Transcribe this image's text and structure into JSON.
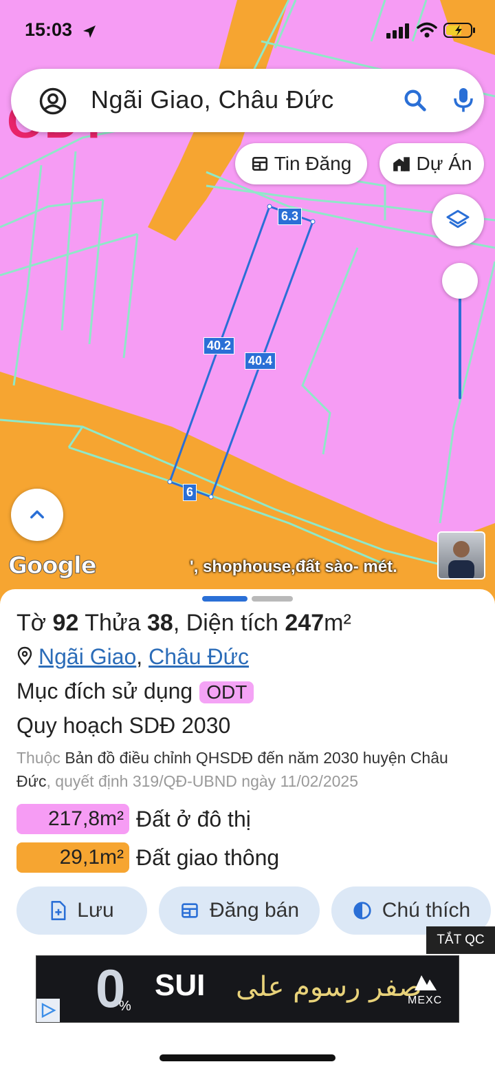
{
  "status_bar": {
    "time": "15:03"
  },
  "search": {
    "query": "Ngãi Giao, Châu Đức"
  },
  "chips": {
    "tin_dang": "Tin Đăng",
    "du_an": "Dự Án"
  },
  "map": {
    "edge_labels": [
      "6.3",
      "40.2",
      "40.4",
      "6"
    ],
    "odt_watermark": "ODT",
    "google_logo": "Google",
    "marquee_text": "', shophouse,đất sào- mét.",
    "colors": {
      "residential": "#f69cf4",
      "road": "#f6a531",
      "boundary": "#8fe8c8",
      "parcel": "#2a6fd6"
    }
  },
  "sheet": {
    "title": {
      "to_label": "Tờ",
      "to_value": "92",
      "thua_label": "Thửa",
      "thua_value": "38",
      "sep": ",",
      "area_label": "Diện tích",
      "area_value": "247",
      "area_unit": "m²"
    },
    "location": {
      "commune": "Ngãi Giao",
      "comma": ",",
      "district": "Châu Đức"
    },
    "purpose": {
      "label": "Mục đích sử dụng",
      "code": "ODT"
    },
    "plan_title": "Quy hoạch SDĐ 2030",
    "plan_desc": {
      "prefix": "Thuộc",
      "main": "Bản đồ điều chỉnh QHSDĐ đến năm 2030 huyện Châu Đức",
      "decision": ", quyết định 319/QĐ-UBND ngày 11/02/2025"
    },
    "areas": [
      {
        "value": "217,8m²",
        "name": "Đất ở đô thị",
        "color": "#f69cf4"
      },
      {
        "value": "29,1m²",
        "name": "Đất giao thông",
        "color": "#f6a531"
      }
    ],
    "buttons": {
      "save": "Lưu",
      "post": "Đăng bán",
      "legend": "Chú thích"
    },
    "ad_toggle": "TẮT QC"
  },
  "ad": {
    "brand": "SUI",
    "arabic": "صفر رسوم على",
    "zero": "0",
    "percent": "%",
    "sponsor": "MEXC"
  }
}
